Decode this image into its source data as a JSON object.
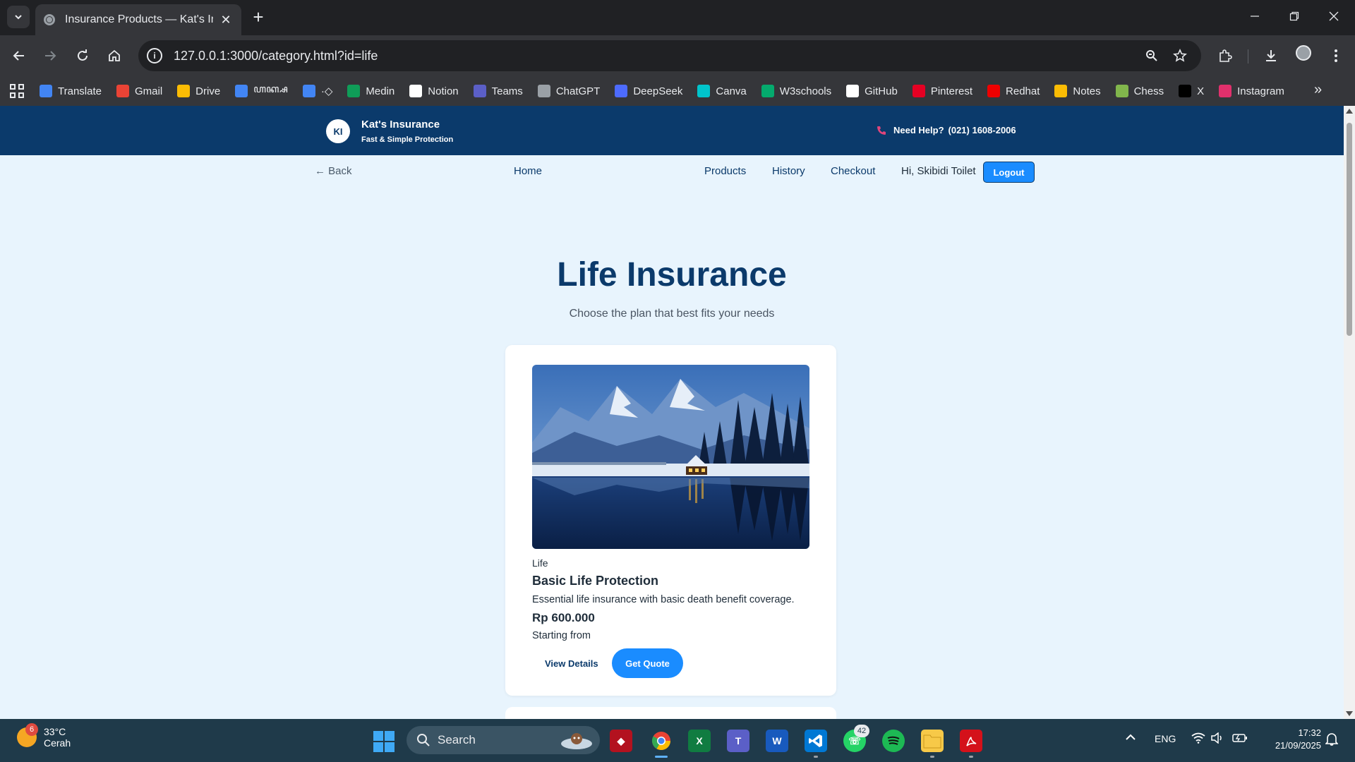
{
  "browser": {
    "tab_title": "Insurance Products — Kat's Insu",
    "url": "127.0.0.1:3000/category.html?id=life",
    "bookmarks": [
      {
        "label": "Translate",
        "icon": "translate-icon",
        "color": "#4285f4"
      },
      {
        "label": "Gmail",
        "icon": "gmail-icon",
        "color": "#ea4335"
      },
      {
        "label": "Drive",
        "icon": "drive-icon",
        "color": "#fbbc04"
      },
      {
        "label": "ꦲꦏ꧀ꦱ",
        "icon": "docs-icon",
        "color": "#4285f4"
      },
      {
        "label": "·◇",
        "icon": "docs-icon",
        "color": "#4285f4"
      },
      {
        "label": "Medin",
        "icon": "sheets-icon",
        "color": "#0f9d58"
      },
      {
        "label": "Notion",
        "icon": "notion-icon",
        "color": "#ffffff"
      },
      {
        "label": "Teams",
        "icon": "teams-icon",
        "color": "#5b5fc7"
      },
      {
        "label": "ChatGPT",
        "icon": "chatgpt-icon",
        "color": "#9aa0a6"
      },
      {
        "label": "DeepSeek",
        "icon": "deepseek-icon",
        "color": "#4d6bfe"
      },
      {
        "label": "Canva",
        "icon": "canva-icon",
        "color": "#00c4cc"
      },
      {
        "label": "W3schools",
        "icon": "w3schools-icon",
        "color": "#04aa6d"
      },
      {
        "label": "GitHub",
        "icon": "github-icon",
        "color": "#ffffff"
      },
      {
        "label": "Pinterest",
        "icon": "pinterest-icon",
        "color": "#e60023"
      },
      {
        "label": "Redhat",
        "icon": "redhat-icon",
        "color": "#ee0000"
      },
      {
        "label": "Notes",
        "icon": "notes-icon",
        "color": "#fbbc04"
      },
      {
        "label": "Chess",
        "icon": "chess-icon",
        "color": "#81b64c"
      },
      {
        "label": "X",
        "icon": "x-icon",
        "color": "#000000"
      },
      {
        "label": "Instagram",
        "icon": "instagram-icon",
        "color": "#e1306c"
      }
    ]
  },
  "site": {
    "logo_initials": "KI",
    "brand_name": "Kat's Insurance",
    "brand_tagline": "Fast & Simple Protection",
    "help_label": "Need Help?",
    "help_phone": "(021) 1608-2006",
    "nav": {
      "back": "← Back",
      "home": "Home",
      "products": "Products",
      "history": "History",
      "checkout": "Checkout",
      "greeting": "Hi, Skibidi Toilet",
      "logout": "Logout"
    },
    "title": "Life Insurance",
    "subtitle": "Choose the plan that best fits your needs",
    "product": {
      "category": "Life",
      "name": "Basic Life Protection",
      "description": "Essential life insurance with basic death benefit coverage.",
      "price": "Rp 600.000",
      "price_note": "Starting from",
      "details_button": "View Details",
      "quote_button": "Get Quote"
    },
    "colors": {
      "header_bg": "#0b3a6b",
      "accent": "#1a8cff",
      "page_bg": "#e8f4fd"
    }
  },
  "taskbar": {
    "weather_badge": "6",
    "temperature": "33°C",
    "condition": "Cerah",
    "search_placeholder": "Search",
    "whatsapp_badge": "42",
    "language": "ENG",
    "time": "17:32",
    "date": "21/09/2025"
  }
}
